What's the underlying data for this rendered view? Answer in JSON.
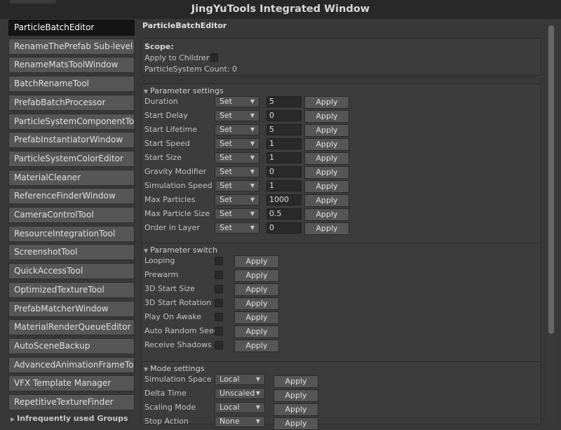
{
  "window": {
    "title": "JingYuTools Integrated Window"
  },
  "sidebar": {
    "items": [
      "ParticleBatchEditor",
      "RenameThePrefab Sub-level",
      "RenameMatsToolWindow",
      "BatchRenameTool",
      "PrefabBatchProcessor",
      "ParticleSystemComponentTool",
      "PrefabInstantiatorWindow",
      "ParticleSystemColorEditor",
      "MaterialCleaner",
      "ReferenceFinderWindow",
      "CameraControlTool",
      "ResourceIntegrationTool",
      "ScreenshotTool",
      "QuickAccessTool",
      "OptimizedTextureTool",
      "PrefabMatcherWindow",
      "MaterialRenderQueueEditor",
      "AutoSceneBackup",
      "AdvancedAnimationFrameTool",
      "VFX Template Manager",
      "RepetitiveTextureFinder"
    ],
    "active_index": 0,
    "groups_label": "Infrequently used Groups"
  },
  "main": {
    "title": "ParticleBatchEditor",
    "scope": {
      "title": "Scope:",
      "apply_children_label": "Apply to Children",
      "apply_children_checked": false,
      "count_label": "ParticleSystem Count:",
      "count_value": "0"
    },
    "apply_label": "Apply",
    "parameter_settings": {
      "title": "Parameter settings",
      "rows": [
        {
          "label": "Duration",
          "mode": "Set",
          "value": "5"
        },
        {
          "label": "Start Delay",
          "mode": "Set",
          "value": "0"
        },
        {
          "label": "Start Lifetime",
          "mode": "Set",
          "value": "5"
        },
        {
          "label": "Start Speed",
          "mode": "Set",
          "value": "1"
        },
        {
          "label": "Start Size",
          "mode": "Set",
          "value": "1"
        },
        {
          "label": "Gravity Modifier",
          "mode": "Set",
          "value": "0"
        },
        {
          "label": "Simulation Speed",
          "mode": "Set",
          "value": "1"
        },
        {
          "label": "Max Particles",
          "mode": "Set",
          "value": "1000"
        },
        {
          "label": "Max Particle Size",
          "mode": "Set",
          "value": "0.5"
        },
        {
          "label": "Order in Layer",
          "mode": "Set",
          "value": "0"
        }
      ]
    },
    "parameter_switch": {
      "title": "Parameter switch",
      "rows": [
        {
          "label": "Looping",
          "checked": false
        },
        {
          "label": "Prewarm",
          "checked": false
        },
        {
          "label": "3D Start Size",
          "checked": false
        },
        {
          "label": "3D Start Rotation",
          "checked": false
        },
        {
          "label": "Play On Awake",
          "checked": false
        },
        {
          "label": "Auto Random Seed",
          "checked": false
        },
        {
          "label": "Receive Shadows",
          "checked": false
        }
      ]
    },
    "mode_settings": {
      "title": "Mode settings",
      "rows": [
        {
          "label": "Simulation Space",
          "value": "Local"
        },
        {
          "label": "Delta Time",
          "value": "Unscaled"
        },
        {
          "label": "Scaling Mode",
          "value": "Local"
        },
        {
          "label": "Stop Action",
          "value": "None"
        }
      ]
    }
  }
}
